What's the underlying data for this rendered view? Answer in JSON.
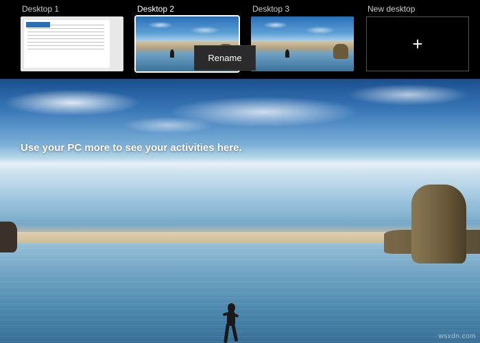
{
  "desktops": [
    {
      "label": "Desktop 1",
      "active": false,
      "type": "document"
    },
    {
      "label": "Desktop 2",
      "active": true,
      "type": "wallpaper"
    },
    {
      "label": "Desktop 3",
      "active": false,
      "type": "wallpaper"
    }
  ],
  "new_desktop_label": "New desktop",
  "context_menu": {
    "rename": "Rename"
  },
  "timeline_message": "Use your PC more to see your activities here.",
  "watermark": "wsxdn.com"
}
